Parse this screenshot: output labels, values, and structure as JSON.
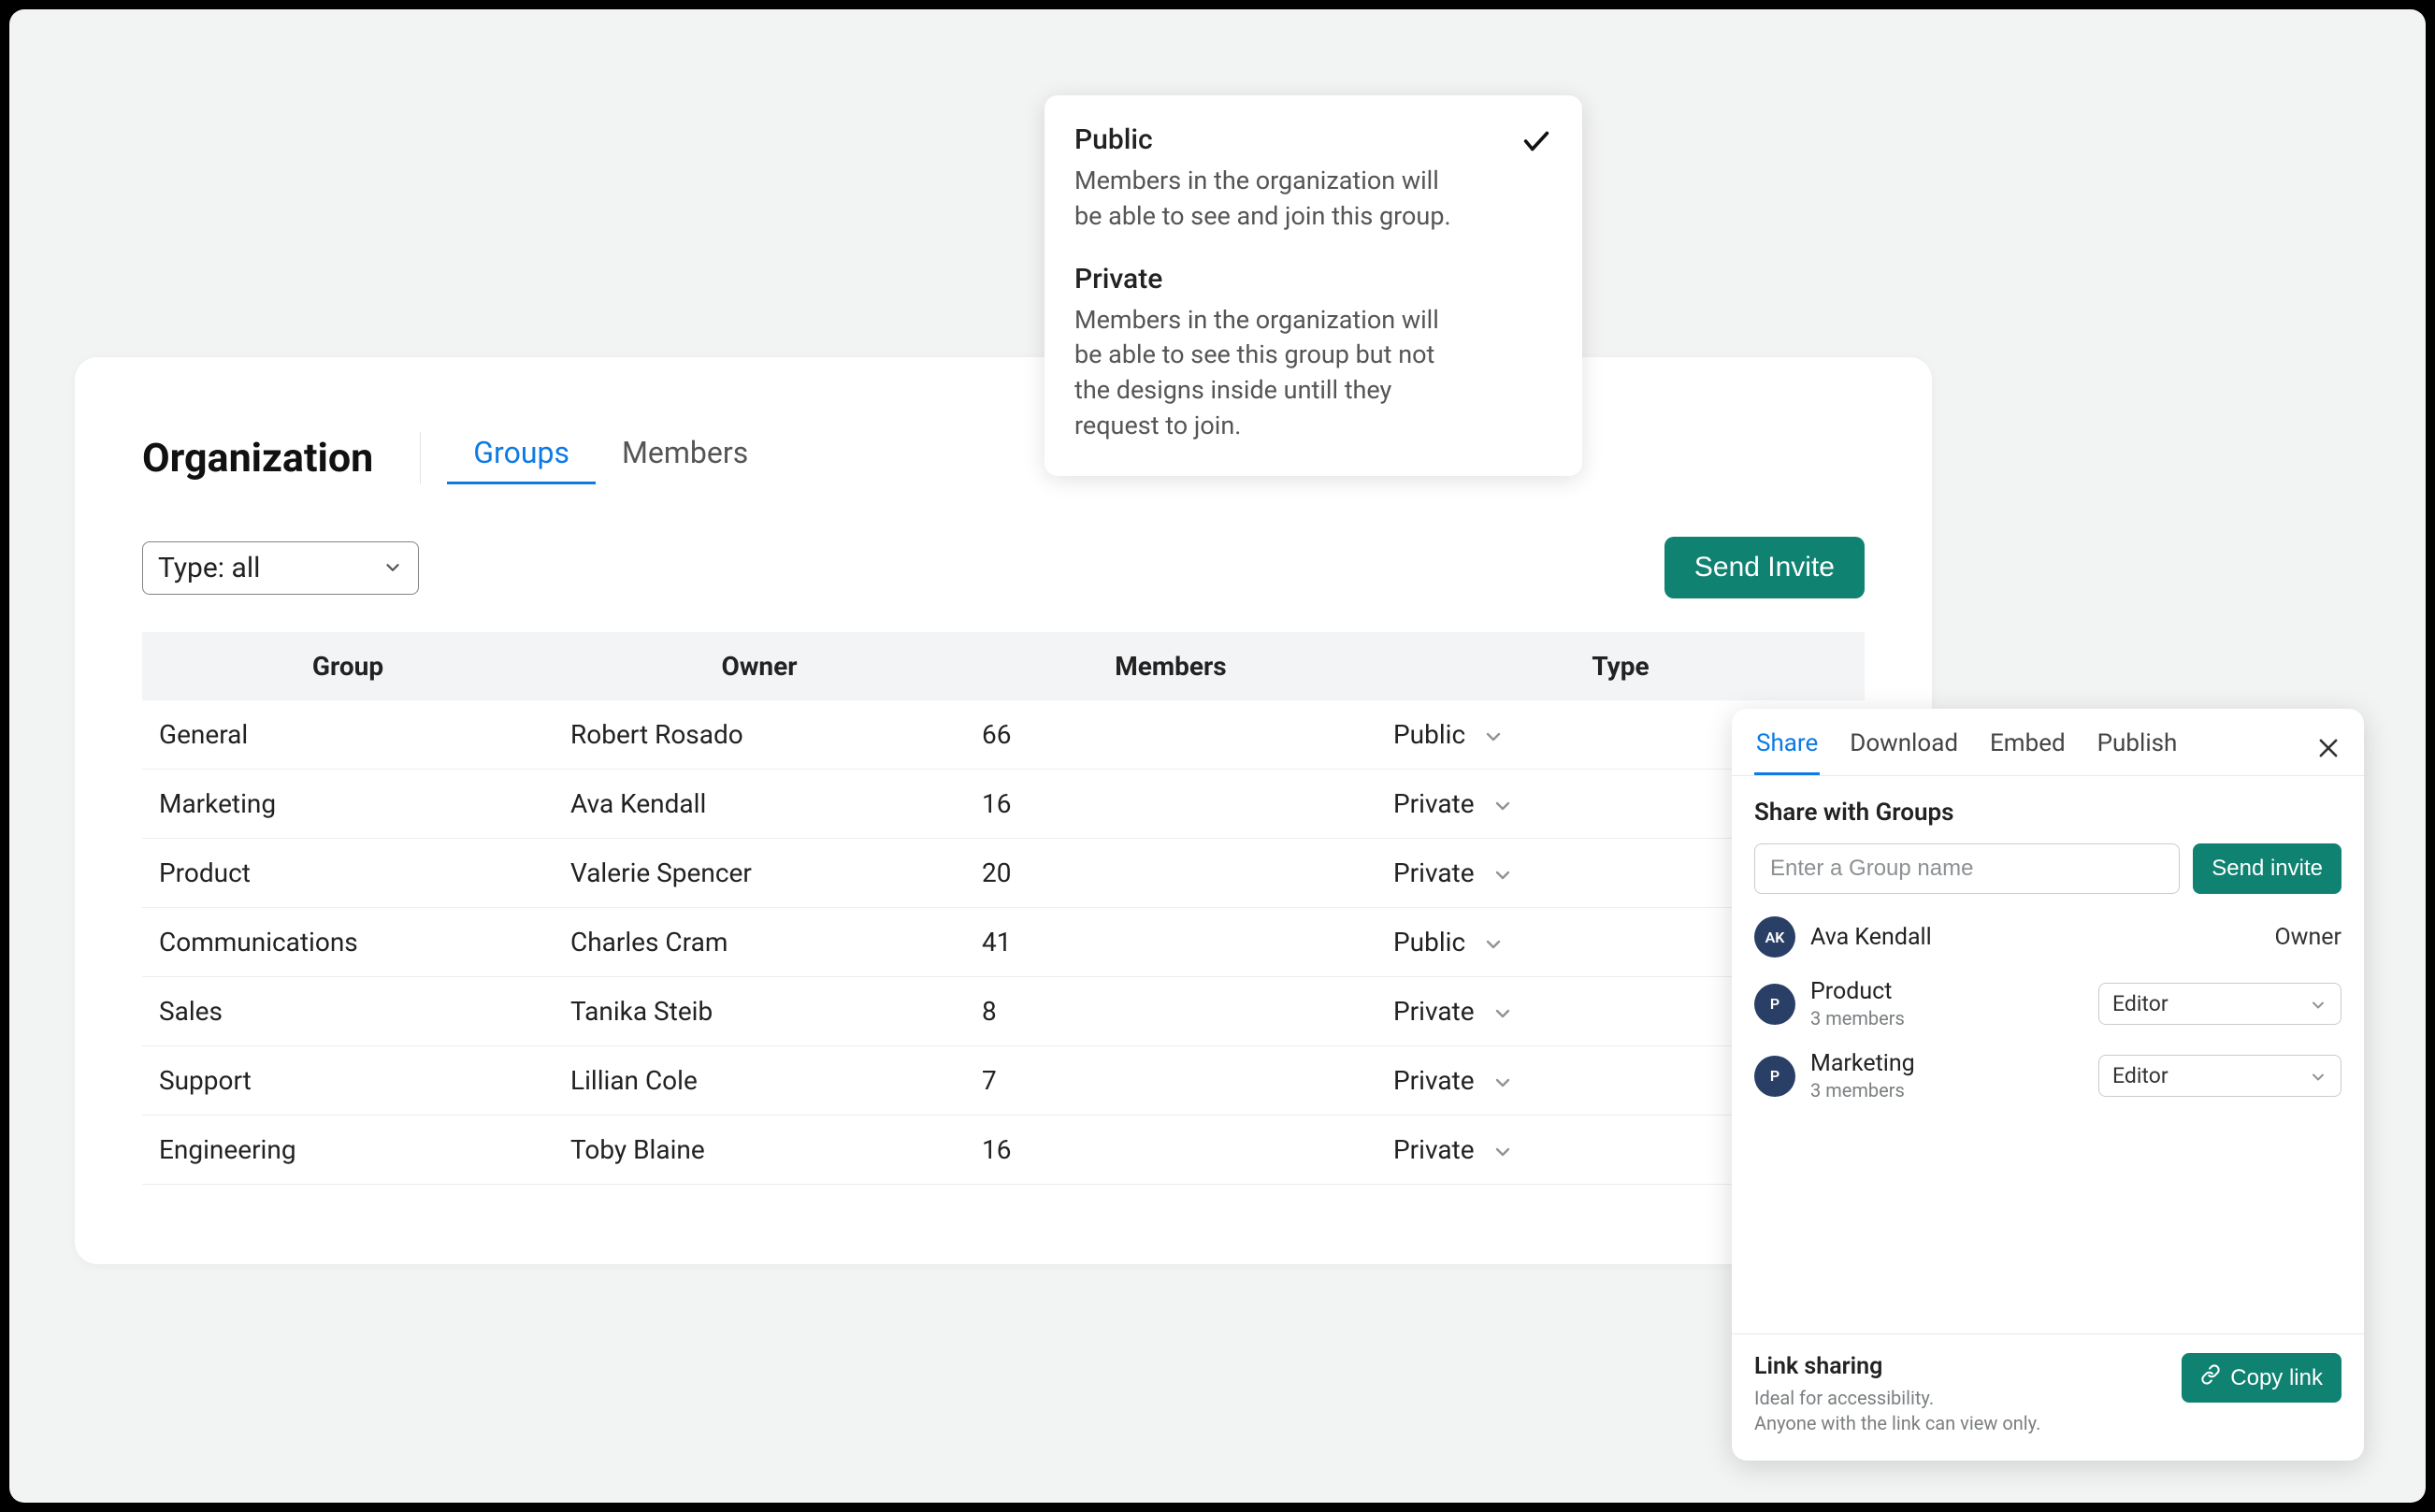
{
  "page": {
    "title": "Organization",
    "tabs": [
      {
        "label": "Groups",
        "active": true
      },
      {
        "label": "Members",
        "active": false
      }
    ],
    "filter": {
      "label": "Type: all"
    },
    "send_invite_label": "Send Invite",
    "columns": {
      "group": "Group",
      "owner": "Owner",
      "members": "Members",
      "type": "Type"
    },
    "rows": [
      {
        "group": "General",
        "owner": "Robert Rosado",
        "members": "66",
        "type": "Public"
      },
      {
        "group": "Marketing",
        "owner": "Ava Kendall",
        "members": "16",
        "type": "Private"
      },
      {
        "group": "Product",
        "owner": "Valerie Spencer",
        "members": "20",
        "type": "Private"
      },
      {
        "group": "Communications",
        "owner": "Charles Cram",
        "members": "41",
        "type": "Public"
      },
      {
        "group": "Sales",
        "owner": "Tanika Steib",
        "members": "8",
        "type": "Private"
      },
      {
        "group": "Support",
        "owner": "Lillian Cole",
        "members": "7",
        "type": "Private"
      },
      {
        "group": "Engineering",
        "owner": "Toby Blaine",
        "members": "16",
        "type": "Private"
      }
    ]
  },
  "visibility": {
    "options": [
      {
        "title": "Public",
        "desc": "Members in the organization will be able to see and join this group.",
        "selected": true
      },
      {
        "title": "Private",
        "desc": "Members in the organization will be able to see this group but not the designs inside untill they request to join.",
        "selected": false
      }
    ]
  },
  "share": {
    "tabs": [
      {
        "label": "Share",
        "active": true
      },
      {
        "label": "Download",
        "active": false
      },
      {
        "label": "Embed",
        "active": false
      },
      {
        "label": "Publish",
        "active": false
      }
    ],
    "heading": "Share with Groups",
    "input_placeholder": "Enter a Group name",
    "send_invite_label": "Send invite",
    "items": [
      {
        "avatar": "AK",
        "name": "Ava Kendall",
        "sub": "",
        "role": "Owner",
        "editable": false
      },
      {
        "avatar": "P",
        "name": "Product",
        "sub": "3 members",
        "role": "Editor",
        "editable": true
      },
      {
        "avatar": "P",
        "name": "Marketing",
        "sub": "3 members",
        "role": "Editor",
        "editable": true
      }
    ],
    "link_sharing": {
      "title": "Link sharing",
      "desc_line1": "Ideal for accessibility.",
      "desc_line2": "Anyone with the link can view only.",
      "button": "Copy link"
    }
  }
}
